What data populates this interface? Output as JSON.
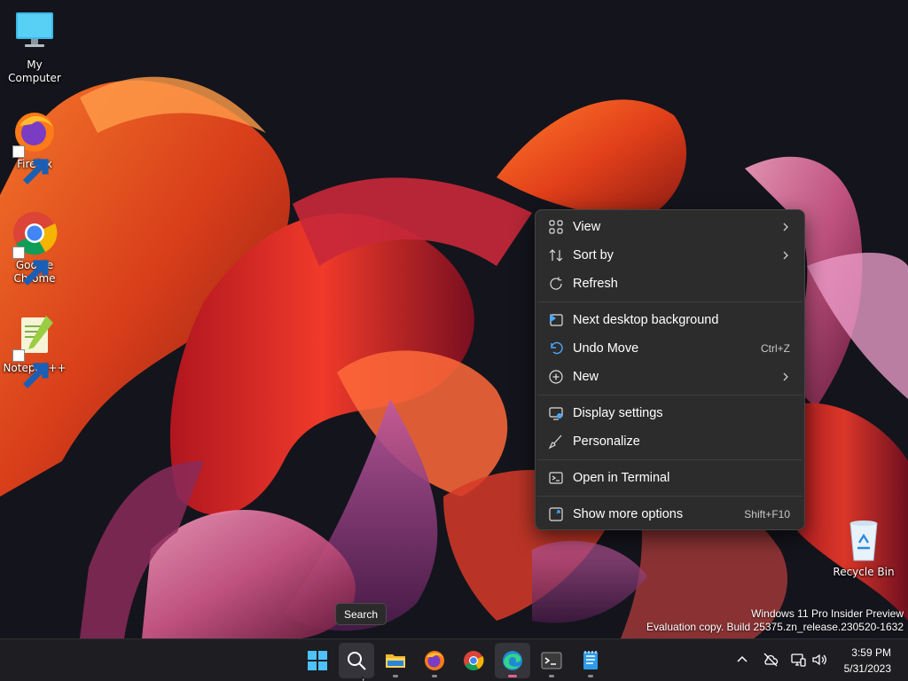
{
  "desktop": {
    "icons": [
      {
        "label": "My Computer",
        "icon": "monitor-icon"
      },
      {
        "label": "Firefox",
        "icon": "firefox-icon"
      },
      {
        "label": "Google Chrome",
        "icon": "chrome-icon"
      },
      {
        "label": "Notepad++",
        "icon": "notepadpp-icon"
      },
      {
        "label": "Recycle Bin",
        "icon": "recycle-bin-icon"
      }
    ]
  },
  "context_menu": {
    "items": [
      {
        "label": "View",
        "icon": "grid-icon",
        "submenu": true
      },
      {
        "label": "Sort by",
        "icon": "sort-icon",
        "submenu": true
      },
      {
        "label": "Refresh",
        "icon": "refresh-icon"
      },
      {
        "label": "Next desktop background",
        "icon": "next-background-icon"
      },
      {
        "label": "Undo Move",
        "icon": "undo-icon",
        "shortcut": "Ctrl+Z"
      },
      {
        "label": "New",
        "icon": "new-plus-icon",
        "submenu": true
      },
      {
        "label": "Display settings",
        "icon": "display-settings-icon"
      },
      {
        "label": "Personalize",
        "icon": "brush-icon"
      },
      {
        "label": "Open in Terminal",
        "icon": "terminal-icon"
      },
      {
        "label": "Show more options",
        "icon": "more-options-icon",
        "shortcut": "Shift+F10"
      }
    ]
  },
  "watermark": {
    "line1": "Windows 11 Pro Insider Preview",
    "line2": "Evaluation copy. Build 25375.zn_release.230520-1632"
  },
  "tooltip": {
    "text": "Search"
  },
  "taskbar": {
    "apps": [
      "start-icon",
      "search-icon",
      "file-explorer-icon",
      "firefox-icon",
      "chrome-icon",
      "edge-icon",
      "terminal-icon",
      "notepad-icon"
    ],
    "tray": [
      "chevron-up-icon",
      "network-off-icon",
      "display-network-icon",
      "volume-icon"
    ],
    "time": "3:59 PM",
    "date": "5/31/2023"
  },
  "colors": {
    "wallpaper_bg": "#14141c",
    "menu_bg": "#2c2c2c",
    "taskbar_bg": "#1e1e22",
    "accent_pink": "#e0648e"
  }
}
